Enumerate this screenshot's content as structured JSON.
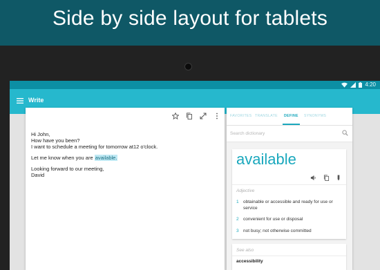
{
  "banner": {
    "headline": "Side by side layout for tablets"
  },
  "statusbar": {
    "time": "4:20",
    "icons": [
      "wifi-icon",
      "signal-icon",
      "battery-icon"
    ]
  },
  "appbar": {
    "title": "Write",
    "menu_icon": "menu-icon"
  },
  "editor": {
    "toolbar_icons": [
      "star-icon",
      "copy-icon",
      "fullscreen-icon",
      "more-vert-icon"
    ],
    "lines": {
      "l1": "Hi John,",
      "l2": "How have you been?",
      "l3": "I want to schedule a meeting for tomorrow at12 o'clock.",
      "l4_prefix": "Let me know when you are ",
      "l4_highlight": "available.",
      "l5": "Looking forward to our meeting,",
      "l6": "David"
    }
  },
  "dictionary": {
    "tabs": [
      "FAVORITES",
      "TRANSLATE",
      "DEFINE",
      "SYNONYMS"
    ],
    "active_tab": "DEFINE",
    "search_placeholder": "Search dictionary",
    "word": "available",
    "card_icons": [
      "volume-icon",
      "copy-icon",
      "edit-icon"
    ],
    "part_of_speech": "Adjective",
    "definitions": [
      {
        "num": "1",
        "text": "obtainable or accessible and ready for use or service"
      },
      {
        "num": "2",
        "text": "convenient for use or disposal"
      },
      {
        "num": "3",
        "text": "not busy; not otherwise committed"
      }
    ],
    "see_also_label": "See also",
    "see_also_word": "accessibility"
  },
  "colors": {
    "banner": "#0f5866",
    "accent": "#26b8cd",
    "status": "#0c8fa4",
    "highlight": "#bfe9f4",
    "bezel": "#222222"
  }
}
